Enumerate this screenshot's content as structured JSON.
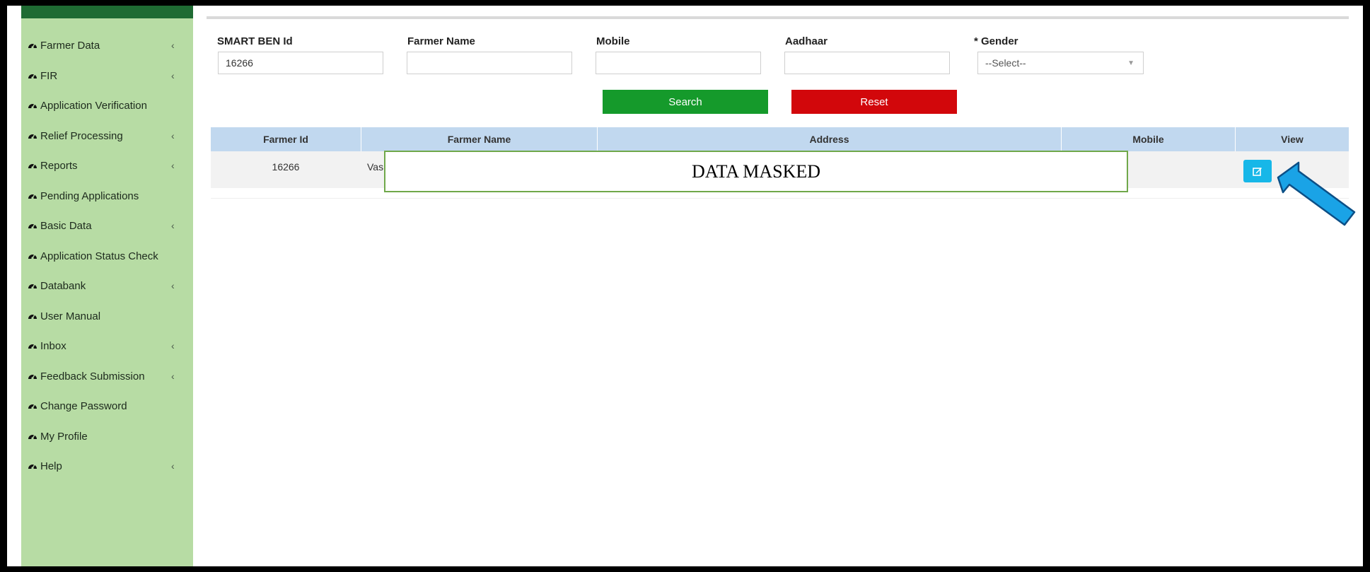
{
  "sidebar": {
    "items": [
      {
        "label": "Farmer Data",
        "has_submenu": true
      },
      {
        "label": "FIR",
        "has_submenu": true
      },
      {
        "label": "Application Verification",
        "has_submenu": false
      },
      {
        "label": "Relief Processing",
        "has_submenu": true
      },
      {
        "label": "Reports",
        "has_submenu": true
      },
      {
        "label": "Pending Applications",
        "has_submenu": false
      },
      {
        "label": "Basic Data",
        "has_submenu": true
      },
      {
        "label": "Application Status Check",
        "has_submenu": false
      },
      {
        "label": "Databank",
        "has_submenu": true
      },
      {
        "label": "User Manual",
        "has_submenu": false
      },
      {
        "label": "Inbox",
        "has_submenu": true
      },
      {
        "label": "Feedback Submission",
        "has_submenu": true
      },
      {
        "label": "Change Password",
        "has_submenu": false
      },
      {
        "label": "My Profile",
        "has_submenu": false
      },
      {
        "label": "Help",
        "has_submenu": true
      }
    ],
    "chevron": "‹",
    "item_icon": "dashboard-gauge-icon"
  },
  "search_form": {
    "smart_ben_id": {
      "label": "SMART BEN Id",
      "value": "16266"
    },
    "farmer_name": {
      "label": "Farmer Name",
      "value": ""
    },
    "mobile": {
      "label": "Mobile",
      "value": ""
    },
    "aadhaar": {
      "label": "Aadhaar",
      "value": ""
    },
    "gender": {
      "label": "* Gender",
      "selected": "--Select--"
    },
    "search_label": "Search",
    "reset_label": "Reset"
  },
  "table": {
    "columns": [
      "Farmer Id",
      "Farmer Name",
      "Address",
      "Mobile",
      "View"
    ],
    "rows": [
      {
        "farmer_id": "16266",
        "farmer_name_fragment": "Vas"
      }
    ],
    "mask_text": "DATA MASKED",
    "view_icon": "edit-icon"
  },
  "colors": {
    "sidebar_bg": "#b7dca4",
    "search_btn": "#159a2b",
    "reset_btn": "#d2070b",
    "view_btn": "#17b7e8",
    "table_header": "#c1d8ef",
    "annotation_arrow": "#1aa3e6"
  }
}
